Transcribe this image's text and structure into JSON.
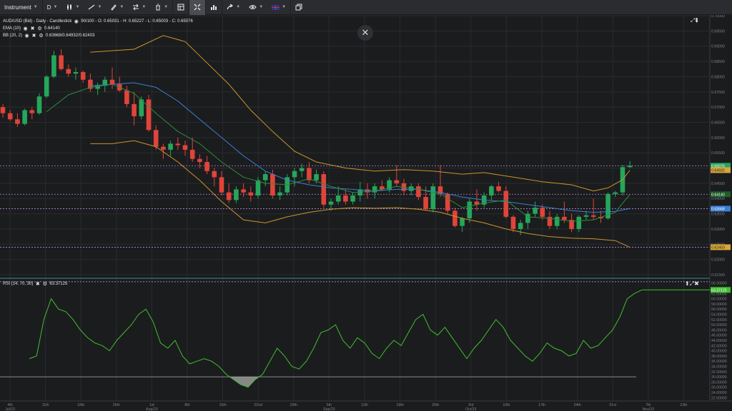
{
  "toolbar": {
    "instrument": "Instrument",
    "timeframe": "D",
    "icons": [
      "candlestick-icon",
      "line-tool-icon",
      "pencil-icon",
      "compare-icon",
      "trash-icon",
      "layout-icon",
      "fit-icon",
      "bar-stats-icon",
      "share-icon",
      "eye-icon",
      "uk-flag-icon",
      "snapshot-icon"
    ]
  },
  "main_pane": {
    "title": "AUD/USD (Bid) - Daily - Candlestick",
    "ohlc": "90/100 - O: 0.65031 - H: 0.65227 - L: 0.65003 - C: 0.65076",
    "ema_label": "EMA (10)",
    "ema_value": "0.64140",
    "bb_label": "BB (20, 2)",
    "bb_value": "0.63668/0.64932/0.62403",
    "price_axis": [
      "0.70000",
      "0.69500",
      "0.69000",
      "0.68500",
      "0.68000",
      "0.67500",
      "0.67000",
      "0.66500",
      "0.66000",
      "0.65500",
      "0.65000",
      "0.64500",
      "0.64000",
      "0.63500",
      "0.63000",
      "0.62500",
      "0.62000",
      "0.61500"
    ],
    "tags": {
      "close": "0.65076",
      "bb_upper": "0.64932",
      "ema": "0.64140",
      "bb_mid": "0.63668",
      "bb_lower": "0.62403"
    }
  },
  "rsi_pane": {
    "label": "RSI (14, 70, 30)",
    "value": "63.37125",
    "axis": [
      "66.00000",
      "62.00000",
      "60.00000",
      "58.00000",
      "56.00000",
      "54.00000",
      "52.00000",
      "50.00000",
      "48.00000",
      "46.00000",
      "44.00000",
      "42.00000",
      "40.00000",
      "38.00000",
      "36.00000",
      "34.00000",
      "32.00000",
      "30.00000",
      "28.00000",
      "26.00000",
      "24.00000",
      "22.00000"
    ]
  },
  "time_axis": [
    {
      "label": "4th",
      "sub": "Jul/23"
    },
    {
      "label": "11th",
      "sub": ""
    },
    {
      "label": "18th",
      "sub": ""
    },
    {
      "label": "25th",
      "sub": ""
    },
    {
      "label": "1st",
      "sub": "Aug/23"
    },
    {
      "label": "8th",
      "sub": ""
    },
    {
      "label": "15th",
      "sub": ""
    },
    {
      "label": "22nd",
      "sub": ""
    },
    {
      "label": "29th",
      "sub": ""
    },
    {
      "label": "5th",
      "sub": "Sep/23"
    },
    {
      "label": "12th",
      "sub": ""
    },
    {
      "label": "19th",
      "sub": ""
    },
    {
      "label": "26th",
      "sub": ""
    },
    {
      "label": "3rd",
      "sub": "Oct/23"
    },
    {
      "label": "10th",
      "sub": ""
    },
    {
      "label": "17th",
      "sub": ""
    },
    {
      "label": "24th",
      "sub": ""
    },
    {
      "label": "31st",
      "sub": ""
    },
    {
      "label": "7th",
      "sub": "Nov/23"
    },
    {
      "label": "13th",
      "sub": ""
    }
  ],
  "colors": {
    "up": "#26a65b",
    "down": "#e0443a",
    "ema": "#2e8b3e",
    "bb_band": "#c9962a",
    "bb_mid": "#3a7fd5",
    "rsi": "#3fbf2e"
  },
  "chart_data": {
    "type": "candlestick",
    "candles": [
      [
        0.67,
        0.671,
        0.6665,
        0.668
      ],
      [
        0.668,
        0.669,
        0.6655,
        0.666
      ],
      [
        0.666,
        0.668,
        0.6635,
        0.6645
      ],
      [
        0.6645,
        0.6695,
        0.664,
        0.669
      ],
      [
        0.669,
        0.67,
        0.666,
        0.668
      ],
      [
        0.668,
        0.6745,
        0.6675,
        0.6735
      ],
      [
        0.6735,
        0.6805,
        0.673,
        0.68
      ],
      [
        0.68,
        0.6885,
        0.6795,
        0.687
      ],
      [
        0.687,
        0.689,
        0.682,
        0.6825
      ],
      [
        0.6825,
        0.684,
        0.68,
        0.681
      ],
      [
        0.681,
        0.683,
        0.679,
        0.6815
      ],
      [
        0.6815,
        0.682,
        0.678,
        0.679
      ],
      [
        0.679,
        0.681,
        0.675,
        0.676
      ],
      [
        0.676,
        0.678,
        0.674,
        0.677
      ],
      [
        0.677,
        0.68,
        0.675,
        0.679
      ],
      [
        0.679,
        0.683,
        0.676,
        0.6775
      ],
      [
        0.6775,
        0.68,
        0.675,
        0.6755
      ],
      [
        0.6755,
        0.677,
        0.67,
        0.671
      ],
      [
        0.671,
        0.675,
        0.664,
        0.667
      ],
      [
        0.667,
        0.6735,
        0.666,
        0.6725
      ],
      [
        0.6725,
        0.674,
        0.662,
        0.6625
      ],
      [
        0.6625,
        0.664,
        0.656,
        0.657
      ],
      [
        0.657,
        0.658,
        0.653,
        0.656
      ],
      [
        0.656,
        0.659,
        0.654,
        0.658
      ],
      [
        0.658,
        0.66,
        0.656,
        0.6575
      ],
      [
        0.6575,
        0.659,
        0.654,
        0.656
      ],
      [
        0.656,
        0.66,
        0.652,
        0.653
      ],
      [
        0.653,
        0.6545,
        0.65,
        0.652
      ],
      [
        0.652,
        0.654,
        0.648,
        0.649
      ],
      [
        0.649,
        0.65,
        0.644,
        0.647
      ],
      [
        0.647,
        0.649,
        0.641,
        0.642
      ],
      [
        0.642,
        0.645,
        0.6385,
        0.6395
      ],
      [
        0.6395,
        0.644,
        0.6385,
        0.643
      ],
      [
        0.643,
        0.645,
        0.6405,
        0.642
      ],
      [
        0.642,
        0.644,
        0.639,
        0.641
      ],
      [
        0.641,
        0.647,
        0.64,
        0.646
      ],
      [
        0.646,
        0.649,
        0.644,
        0.648
      ],
      [
        0.648,
        0.6495,
        0.64,
        0.641
      ],
      [
        0.641,
        0.644,
        0.6395,
        0.642
      ],
      [
        0.642,
        0.648,
        0.641,
        0.647
      ],
      [
        0.647,
        0.65,
        0.644,
        0.649
      ],
      [
        0.649,
        0.6515,
        0.647,
        0.65
      ],
      [
        0.65,
        0.652,
        0.645,
        0.646
      ],
      [
        0.646,
        0.6495,
        0.645,
        0.648
      ],
      [
        0.648,
        0.649,
        0.637,
        0.638
      ],
      [
        0.638,
        0.64,
        0.636,
        0.639
      ],
      [
        0.639,
        0.644,
        0.638,
        0.641
      ],
      [
        0.641,
        0.643,
        0.638,
        0.639
      ],
      [
        0.639,
        0.642,
        0.638,
        0.641
      ],
      [
        0.641,
        0.6455,
        0.639,
        0.643
      ],
      [
        0.643,
        0.645,
        0.64,
        0.642
      ],
      [
        0.642,
        0.645,
        0.64,
        0.644
      ],
      [
        0.644,
        0.646,
        0.6425,
        0.643
      ],
      [
        0.643,
        0.647,
        0.642,
        0.646
      ],
      [
        0.646,
        0.651,
        0.644,
        0.645
      ],
      [
        0.645,
        0.6465,
        0.641,
        0.6425
      ],
      [
        0.6425,
        0.645,
        0.641,
        0.644
      ],
      [
        0.644,
        0.645,
        0.6395,
        0.6405
      ],
      [
        0.6405,
        0.644,
        0.636,
        0.6365
      ],
      [
        0.6365,
        0.645,
        0.6355,
        0.644
      ],
      [
        0.644,
        0.651,
        0.6405,
        0.6415
      ],
      [
        0.6415,
        0.642,
        0.635,
        0.636
      ],
      [
        0.636,
        0.637,
        0.6305,
        0.631
      ],
      [
        0.631,
        0.634,
        0.629,
        0.6335
      ],
      [
        0.6335,
        0.64,
        0.632,
        0.639
      ],
      [
        0.639,
        0.643,
        0.636,
        0.638
      ],
      [
        0.638,
        0.642,
        0.637,
        0.641
      ],
      [
        0.641,
        0.6445,
        0.6395,
        0.644
      ],
      [
        0.644,
        0.6455,
        0.642,
        0.6425
      ],
      [
        0.6425,
        0.644,
        0.6335,
        0.634
      ],
      [
        0.634,
        0.6345,
        0.629,
        0.63
      ],
      [
        0.63,
        0.633,
        0.628,
        0.632
      ],
      [
        0.632,
        0.636,
        0.63,
        0.635
      ],
      [
        0.635,
        0.639,
        0.634,
        0.637
      ],
      [
        0.637,
        0.638,
        0.633,
        0.634
      ],
      [
        0.634,
        0.636,
        0.63,
        0.631
      ],
      [
        0.631,
        0.635,
        0.63,
        0.634
      ],
      [
        0.634,
        0.639,
        0.632,
        0.633
      ],
      [
        0.633,
        0.635,
        0.629,
        0.63
      ],
      [
        0.63,
        0.6345,
        0.629,
        0.634
      ],
      [
        0.634,
        0.636,
        0.633,
        0.6345
      ],
      [
        0.6345,
        0.64,
        0.633,
        0.634
      ],
      [
        0.634,
        0.636,
        0.632,
        0.6335
      ],
      [
        0.6335,
        0.642,
        0.633,
        0.6415
      ],
      [
        0.6415,
        0.6425,
        0.6405,
        0.642
      ],
      [
        0.642,
        0.651,
        0.641,
        0.6503
      ],
      [
        0.6503,
        0.6523,
        0.65,
        0.6508
      ]
    ],
    "ema": [
      [
        6,
        0.6685
      ],
      [
        9,
        0.674
      ],
      [
        12,
        0.6765
      ],
      [
        15,
        0.6775
      ],
      [
        18,
        0.6745
      ],
      [
        21,
        0.668
      ],
      [
        24,
        0.662
      ],
      [
        27,
        0.658
      ],
      [
        30,
        0.652
      ],
      [
        33,
        0.647
      ],
      [
        36,
        0.645
      ],
      [
        39,
        0.6445
      ],
      [
        42,
        0.6465
      ],
      [
        45,
        0.644
      ],
      [
        48,
        0.642
      ],
      [
        51,
        0.6425
      ],
      [
        54,
        0.644
      ],
      [
        57,
        0.643
      ],
      [
        60,
        0.6415
      ],
      [
        63,
        0.637
      ],
      [
        66,
        0.6385
      ],
      [
        69,
        0.6395
      ],
      [
        72,
        0.634
      ],
      [
        75,
        0.6335
      ],
      [
        78,
        0.6325
      ],
      [
        81,
        0.633
      ],
      [
        84,
        0.6355
      ],
      [
        86,
        0.6414
      ]
    ],
    "bb_upper": [
      [
        12,
        0.688
      ],
      [
        18,
        0.689
      ],
      [
        22,
        0.6935
      ],
      [
        25,
        0.6915
      ],
      [
        28,
        0.6845
      ],
      [
        31,
        0.6775
      ],
      [
        34,
        0.669
      ],
      [
        37,
        0.662
      ],
      [
        40,
        0.6555
      ],
      [
        43,
        0.652
      ],
      [
        47,
        0.65
      ],
      [
        51,
        0.649
      ],
      [
        55,
        0.6495
      ],
      [
        59,
        0.649
      ],
      [
        63,
        0.648
      ],
      [
        66,
        0.6485
      ],
      [
        70,
        0.647
      ],
      [
        74,
        0.6455
      ],
      [
        78,
        0.6445
      ],
      [
        81,
        0.6425
      ],
      [
        83,
        0.6435
      ],
      [
        85,
        0.6462
      ],
      [
        86,
        0.6493
      ]
    ],
    "bb_mid": [
      [
        12,
        0.677
      ],
      [
        15,
        0.6775
      ],
      [
        18,
        0.678
      ],
      [
        21,
        0.6765
      ],
      [
        24,
        0.672
      ],
      [
        27,
        0.666
      ],
      [
        30,
        0.66
      ],
      [
        33,
        0.654
      ],
      [
        36,
        0.649
      ],
      [
        39,
        0.646
      ],
      [
        42,
        0.6445
      ],
      [
        45,
        0.6435
      ],
      [
        48,
        0.643
      ],
      [
        51,
        0.6425
      ],
      [
        54,
        0.643
      ],
      [
        57,
        0.643
      ],
      [
        60,
        0.642
      ],
      [
        63,
        0.6405
      ],
      [
        66,
        0.6395
      ],
      [
        69,
        0.639
      ],
      [
        72,
        0.638
      ],
      [
        75,
        0.637
      ],
      [
        78,
        0.636
      ],
      [
        81,
        0.6355
      ],
      [
        84,
        0.6358
      ],
      [
        86,
        0.6367
      ]
    ],
    "bb_lower": [
      [
        12,
        0.658
      ],
      [
        15,
        0.658
      ],
      [
        18,
        0.659
      ],
      [
        21,
        0.657
      ],
      [
        24,
        0.652
      ],
      [
        27,
        0.646
      ],
      [
        30,
        0.639
      ],
      [
        33,
        0.633
      ],
      [
        36,
        0.632
      ],
      [
        39,
        0.634
      ],
      [
        42,
        0.6355
      ],
      [
        45,
        0.6365
      ],
      [
        48,
        0.637
      ],
      [
        51,
        0.6368
      ],
      [
        54,
        0.637
      ],
      [
        57,
        0.6365
      ],
      [
        60,
        0.6355
      ],
      [
        63,
        0.6335
      ],
      [
        66,
        0.632
      ],
      [
        69,
        0.63
      ],
      [
        72,
        0.6285
      ],
      [
        75,
        0.6275
      ],
      [
        78,
        0.627
      ],
      [
        81,
        0.6268
      ],
      [
        84,
        0.6262
      ],
      [
        86,
        0.624
      ]
    ],
    "rsi": [
      37,
      38,
      52,
      60,
      56,
      55,
      52,
      48,
      45,
      43,
      42,
      40,
      44,
      47,
      50,
      54,
      56,
      51,
      43,
      41,
      44,
      38,
      35,
      36,
      37,
      36,
      34,
      31,
      29,
      27,
      26,
      29,
      31,
      36,
      41,
      38,
      34,
      33,
      36,
      41,
      47,
      48,
      50,
      44,
      41,
      45,
      43,
      39,
      37,
      41,
      44,
      42,
      47,
      52,
      54,
      48,
      46,
      49,
      45,
      41,
      37,
      41,
      44,
      48,
      52,
      49,
      44,
      41,
      38,
      36,
      39,
      43,
      41,
      40,
      38,
      39,
      44,
      41,
      42,
      45,
      48,
      53,
      60,
      62,
      63.37
    ]
  }
}
